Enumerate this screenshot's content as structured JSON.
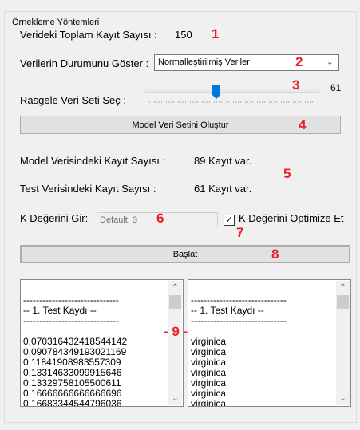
{
  "group": {
    "title": "Örnekleme Yöntemleri"
  },
  "total": {
    "label": "Verideki Toplam Kayıt Sayısı :",
    "value": "150"
  },
  "state": {
    "label": "Verilerin Durumunu Göster :",
    "selected": "Normalleştirilmiş Veriler"
  },
  "random": {
    "label": "Rasgele Veri Seti Seç :",
    "value": "61",
    "slider_fraction": 0.41
  },
  "create_button": "Model Veri Setini Oluştur",
  "model_count": {
    "label": "Model Verisindeki Kayıt Sayısı :",
    "value": "89 Kayıt var."
  },
  "test_count": {
    "label": "Test Verisindeki Kayıt Sayısı :",
    "value": "61 Kayıt var."
  },
  "k": {
    "label": "K Değerini Gir:",
    "placeholder": "Default: 3",
    "optimize_label": "K Değerini Optimize Et",
    "optimize_checked": true
  },
  "start_button": "Başlat",
  "annotations": [
    "1",
    "2",
    "3",
    "4",
    "5",
    "6",
    "7",
    "8",
    "- 9 -"
  ],
  "list_left": [
    "",
    "------------------------------",
    "-- 1. Test Kaydı --",
    "------------------------------",
    "",
    "0,070316432418544142",
    "0,090784349193021169",
    "0,11841908983557309",
    "0,13314633099915646",
    "0,13329758105500611",
    "0,16666666666666696",
    "0,16683344544796036"
  ],
  "list_right": [
    "",
    "------------------------------",
    "-- 1. Test Kaydı --",
    "------------------------------",
    "",
    "virginica",
    "virginica",
    "virginica",
    "virginica",
    "virginica",
    "virginica",
    "virginica"
  ]
}
